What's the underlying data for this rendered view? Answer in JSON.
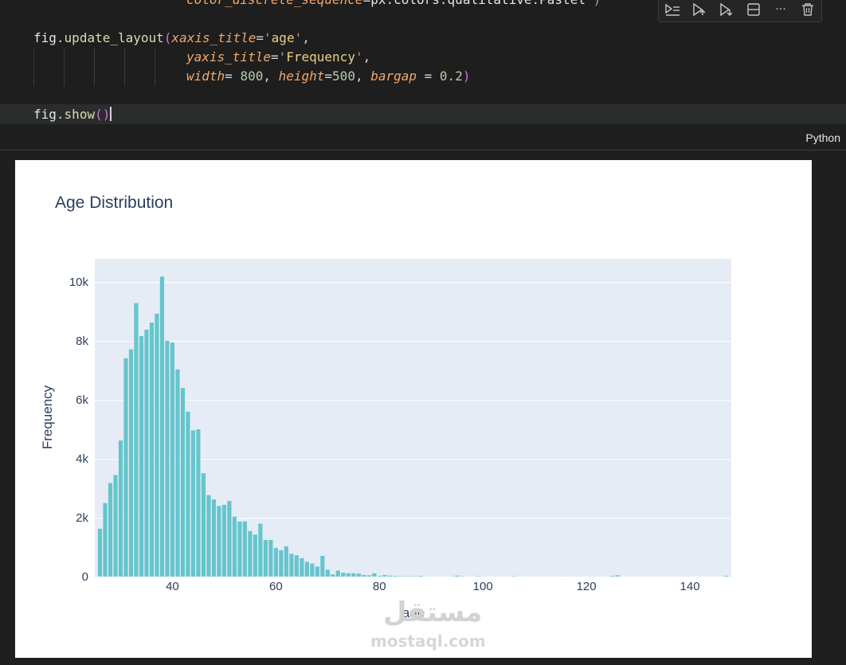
{
  "code": {
    "line0": {
      "kw": "color_discrete_sequence",
      "eq": "=",
      "mod": "px",
      "d1": ".",
      "a1": "colors",
      "d2": ".",
      "a2": "qualitative",
      "d3": ".",
      "a3": "Pastel",
      "end": "')"
    },
    "line1": {
      "obj": "fig",
      "dot": ".",
      "fn": "update_layout",
      "open": "(",
      "kw": "xaxis_title",
      "eq": "=",
      "q1": "'",
      "val": "age",
      "q2": "'",
      "comma": ","
    },
    "line2": {
      "kw": "yaxis_title",
      "eq": "=",
      "q1": "'",
      "val": "Frequency",
      "q2": "'",
      "comma": ","
    },
    "line3": {
      "kw1": "width",
      "eq1": "= ",
      "n1": "800",
      "c1": ", ",
      "kw2": "height",
      "eq2": "=",
      "n2": "500",
      "c2": ", ",
      "kw3": "bargap",
      "eq3": " = ",
      "n3": "0.2",
      "close": ")"
    },
    "line4": {
      "obj": "fig",
      "dot": ".",
      "fn": "show",
      "open": "(",
      "close": ")"
    }
  },
  "toolbar": {
    "icons": [
      "run-by-line-icon",
      "execute-above-icon",
      "execute-below-icon",
      "split-cell-icon",
      "more-icon",
      "delete-icon"
    ],
    "more_label": "···"
  },
  "language": "Python",
  "watermark": {
    "brand_ar": "مستقل",
    "brand_en": "mostaql.com"
  },
  "chart_data": {
    "type": "bar",
    "title": "Age Distribution",
    "xlabel": "age",
    "ylabel": "Frequency",
    "bar_color": "#66c5cc",
    "plot_bg": "#e5ecf6",
    "xlim": [
      25,
      148
    ],
    "ylim": [
      0,
      10800
    ],
    "bin_width": 1,
    "x_ticks": [
      {
        "v": 40,
        "label": "40"
      },
      {
        "v": 60,
        "label": "60"
      },
      {
        "v": 80,
        "label": "80"
      },
      {
        "v": 100,
        "label": "100"
      },
      {
        "v": 120,
        "label": "120"
      },
      {
        "v": 140,
        "label": "140"
      }
    ],
    "y_ticks": [
      {
        "v": 0,
        "label": "0"
      },
      {
        "v": 2000,
        "label": "2k"
      },
      {
        "v": 4000,
        "label": "4k"
      },
      {
        "v": 6000,
        "label": "6k"
      },
      {
        "v": 8000,
        "label": "8k"
      },
      {
        "v": 10000,
        "label": "10k"
      }
    ],
    "bars": [
      [
        26,
        1650
      ],
      [
        27,
        2520
      ],
      [
        28,
        3200
      ],
      [
        29,
        3470
      ],
      [
        30,
        4640
      ],
      [
        31,
        7430
      ],
      [
        32,
        7730
      ],
      [
        33,
        9300
      ],
      [
        34,
        8180
      ],
      [
        35,
        8400
      ],
      [
        36,
        8640
      ],
      [
        37,
        8940
      ],
      [
        38,
        10200
      ],
      [
        39,
        8020
      ],
      [
        40,
        7960
      ],
      [
        41,
        7050
      ],
      [
        42,
        6420
      ],
      [
        43,
        5620
      ],
      [
        44,
        4980
      ],
      [
        45,
        5020
      ],
      [
        46,
        3530
      ],
      [
        47,
        2790
      ],
      [
        48,
        2640
      ],
      [
        49,
        2420
      ],
      [
        50,
        2460
      ],
      [
        51,
        2590
      ],
      [
        52,
        2060
      ],
      [
        53,
        1890
      ],
      [
        54,
        1900
      ],
      [
        55,
        1570
      ],
      [
        56,
        1450
      ],
      [
        57,
        1820
      ],
      [
        58,
        1270
      ],
      [
        59,
        1270
      ],
      [
        60,
        1000
      ],
      [
        61,
        920
      ],
      [
        62,
        1050
      ],
      [
        63,
        800
      ],
      [
        64,
        750
      ],
      [
        65,
        650
      ],
      [
        66,
        530
      ],
      [
        67,
        470
      ],
      [
        68,
        370
      ],
      [
        69,
        730
      ],
      [
        70,
        260
      ],
      [
        71,
        100
      ],
      [
        72,
        230
      ],
      [
        73,
        160
      ],
      [
        74,
        140
      ],
      [
        75,
        140
      ],
      [
        76,
        130
      ],
      [
        77,
        80
      ],
      [
        78,
        70
      ],
      [
        79,
        140
      ],
      [
        80,
        50
      ],
      [
        81,
        80
      ],
      [
        82,
        60
      ],
      [
        83,
        50
      ],
      [
        84,
        40
      ],
      [
        85,
        40
      ],
      [
        86,
        40
      ],
      [
        87,
        40
      ],
      [
        88,
        50
      ],
      [
        89,
        30
      ],
      [
        90,
        20
      ],
      [
        91,
        20
      ],
      [
        92,
        20
      ],
      [
        93,
        20
      ],
      [
        94,
        30
      ],
      [
        95,
        60
      ],
      [
        96,
        40
      ],
      [
        97,
        20
      ],
      [
        98,
        20
      ],
      [
        99,
        40
      ],
      [
        100,
        30
      ],
      [
        101,
        20
      ],
      [
        102,
        20
      ],
      [
        103,
        15
      ],
      [
        104,
        15
      ],
      [
        105,
        15
      ],
      [
        106,
        40
      ],
      [
        107,
        15
      ],
      [
        108,
        10
      ],
      [
        109,
        10
      ],
      [
        110,
        10
      ],
      [
        111,
        10
      ],
      [
        112,
        10
      ],
      [
        113,
        10
      ],
      [
        114,
        10
      ],
      [
        115,
        10
      ],
      [
        116,
        30
      ],
      [
        117,
        10
      ],
      [
        118,
        10
      ],
      [
        119,
        10
      ],
      [
        120,
        10
      ],
      [
        121,
        10
      ],
      [
        122,
        10
      ],
      [
        123,
        10
      ],
      [
        124,
        30
      ],
      [
        125,
        50
      ],
      [
        126,
        70
      ],
      [
        127,
        10
      ],
      [
        128,
        10
      ],
      [
        129,
        10
      ],
      [
        130,
        10
      ],
      [
        131,
        10
      ],
      [
        132,
        10
      ],
      [
        133,
        10
      ],
      [
        134,
        10
      ],
      [
        135,
        10
      ],
      [
        136,
        10
      ],
      [
        137,
        10
      ],
      [
        138,
        10
      ],
      [
        139,
        10
      ],
      [
        140,
        10
      ],
      [
        141,
        10
      ],
      [
        142,
        10
      ],
      [
        143,
        10
      ],
      [
        144,
        10
      ],
      [
        145,
        10
      ],
      [
        146,
        10
      ],
      [
        147,
        50
      ]
    ]
  }
}
